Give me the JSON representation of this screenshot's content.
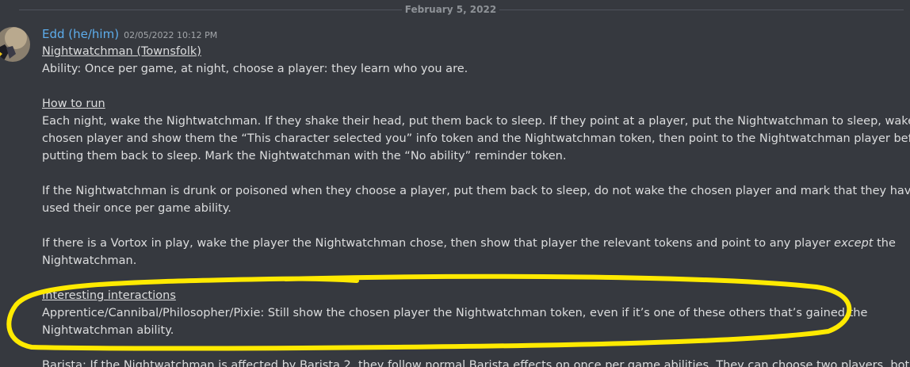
{
  "divider": {
    "date": "February 5, 2022"
  },
  "message": {
    "author": "Edd (he/him)",
    "timestamp": "02/05/2022 10:12 PM",
    "title": "Nightwatchman (Townsfolk)",
    "ability": "Ability: Once per game, at night, choose a player: they learn who you are.",
    "how_to_run_heading": "How to run",
    "how_to_run_lines": [
      "Each night, wake the Nightwatchman. If they shake their head, put them back to sleep. If they point at a player, put the Nightwatchman to sleep, wake the",
      "chosen player and show them the “This character selected you” info token and the Nightwatchman token, then point to the Nightwatchman player before",
      "putting them back to sleep. Mark the Nightwatchman with the “No ability” reminder token."
    ],
    "drunk_lines": [
      "If the Nightwatchman is drunk or poisoned when they choose a player, put them back to sleep, do not wake the chosen player and mark that they have",
      "used their once per game ability."
    ],
    "vortox_line1_before": "If there is a Vortox in play, wake the player the Nightwatchman chose, then show that player the relevant tokens and point to any player ",
    "vortox_line1_emphasis": "except",
    "vortox_line1_after": " the",
    "vortox_line2": "Nightwatchman.",
    "interactions_heading": "Interesting interactions",
    "interactions_lines": [
      "Apprentice/Cannibal/Philosopher/Pixie: Still show the chosen player the Nightwatchman token, even if it’s one of these others that’s gained the",
      "Nightwatchman ability."
    ],
    "barista_partial": "Barista: If the Nightwatchman is affected by Barista 2, they follow normal Barista effects on once per game abilities. They can choose two players, both of"
  },
  "colors": {
    "background": "#36393f",
    "text": "#dcddde",
    "username": "#5dadec",
    "timestamp": "#a3a6aa",
    "divider": "#4f545c",
    "highlight_annotation": "#ffea00"
  },
  "icons": {
    "avatar": "avatar-icon"
  }
}
